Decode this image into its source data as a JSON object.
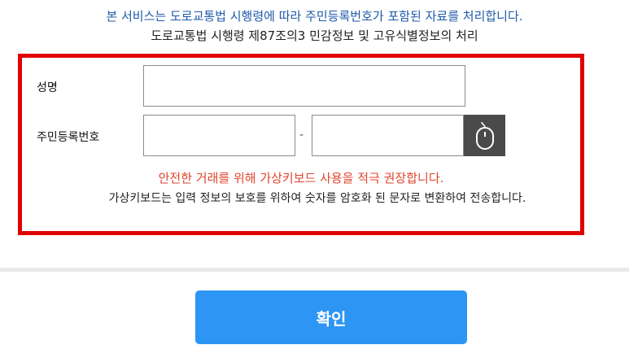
{
  "notice": {
    "line1": "본 서비스는 도로교통법 시행령에 따라 주민등록번호가 포함된 자료를 처리합니다.",
    "line2": "도로교통법 시행령 제87조의3 민감정보 및 고유식별정보의 처리"
  },
  "form": {
    "name_label": "성명",
    "name_value": "",
    "rrn_label": "주민등록번호",
    "rrn_front_value": "",
    "rrn_separator": "-",
    "rrn_back_value": "",
    "virtual_keyboard_icon": "mouse-icon",
    "warning_text": "안전한 거래를 위해 가상키보드 사용을 적극 권장합니다.",
    "info_text": "가상키보드는 입력 정보의 보호를 위하여 숫자를 암호화 된 문자로 변환하여 전송합니다."
  },
  "actions": {
    "confirm_label": "확인"
  },
  "colors": {
    "notice_blue": "#1f5aa8",
    "box_border": "#e00000",
    "warning": "#e0452e",
    "button": "#2d95f3",
    "keyboard_button": "#4a4a4a"
  }
}
